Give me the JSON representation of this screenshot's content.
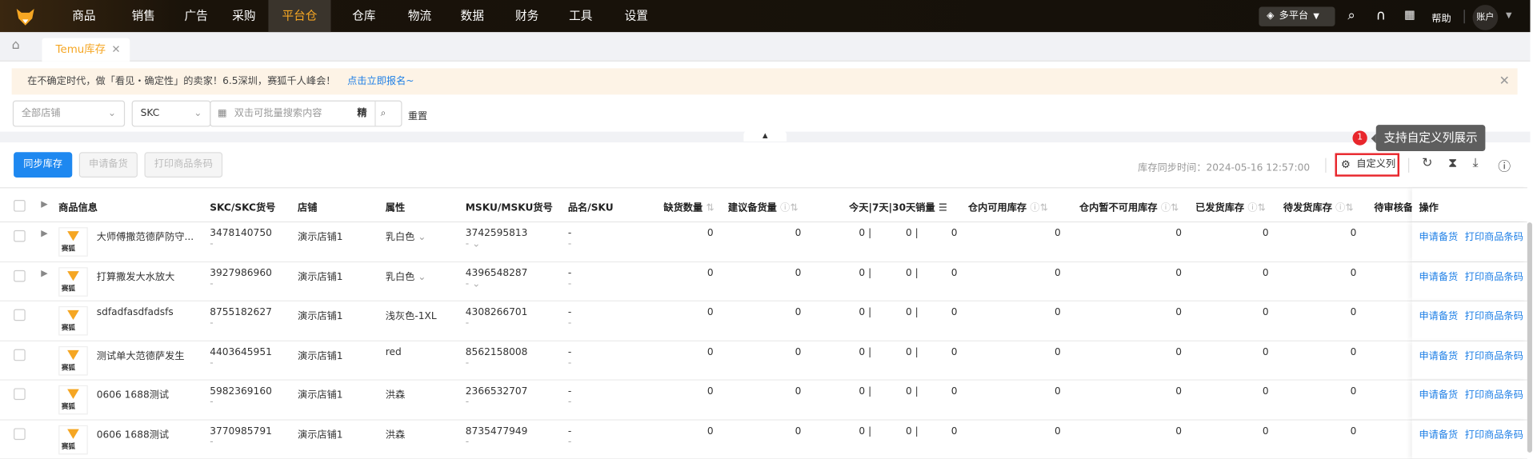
{
  "nav": {
    "items": [
      "商品",
      "销售",
      "广告",
      "采购",
      "平台仓",
      "仓库",
      "物流",
      "数据",
      "财务",
      "工具",
      "设置"
    ],
    "active": "平台仓",
    "platform": "多平台",
    "help": "帮助",
    "account": "账户"
  },
  "tabs": {
    "active": "Temu库存"
  },
  "banner": {
    "text": "在不确定时代，做「看见・确定性」的卖家！6.5深圳，赛狐千人峰会！",
    "link": "点击立即报名~"
  },
  "filters": {
    "store_placeholder": "全部店铺",
    "type": "SKC",
    "search_placeholder": "双击可批量搜索内容",
    "precise": "精",
    "reset": "重置"
  },
  "toolbar": {
    "sync": "同步库存",
    "apply": "申请备货",
    "print": "打印商品条码",
    "sync_time": "库存同步时间：2024-05-16 12:57:00",
    "custom_cols": "自定义列"
  },
  "tooltip": {
    "badge": "1",
    "text": "支持自定义列展示"
  },
  "columns": {
    "info": "商品信息",
    "skc": "SKC/SKC货号",
    "store": "店铺",
    "attr": "属性",
    "msku": "MSKU/MSKU货号",
    "name": "品名/SKU",
    "shortage": "缺货数量",
    "suggest": "建议备货量",
    "sales": "今天|7天|30天销量",
    "avail": "仓内可用库存",
    "unavail": "仓内暂不可用库存",
    "shipped": "已发货库存",
    "pending": "待发货库存",
    "review": "待审核备",
    "ops": "操作"
  },
  "thumb_label": "赛狐",
  "rows": [
    {
      "name": "大师傅撒范德萨防守...",
      "skc": "3478140750",
      "store": "演示店铺1",
      "attr": "乳白色",
      "msku": "3742595813",
      "sku": "-",
      "shortage": "0",
      "suggest": "0",
      "today": "0",
      "d7": "0",
      "d30": "0",
      "avail": "0",
      "unavail": "0",
      "shipped": "0",
      "pending": "0",
      "op1": "申请备货",
      "op2": "打印商品条码",
      "expand": true
    },
    {
      "name": "打算撒发大水放大",
      "skc": "3927986960",
      "store": "演示店铺1",
      "attr": "乳白色",
      "msku": "4396548287",
      "sku": "-",
      "shortage": "0",
      "suggest": "0",
      "today": "0",
      "d7": "0",
      "d30": "0",
      "avail": "0",
      "unavail": "0",
      "shipped": "0",
      "pending": "0",
      "op1": "申请备货",
      "op2": "打印商品条码",
      "expand": true
    },
    {
      "name": "sdfadfasdfadsfs",
      "skc": "8755182627",
      "store": "演示店铺1",
      "attr": "浅灰色-1XL",
      "msku": "4308266701",
      "sku": "-",
      "shortage": "0",
      "suggest": "0",
      "today": "0",
      "d7": "0",
      "d30": "0",
      "avail": "0",
      "unavail": "0",
      "shipped": "0",
      "pending": "0",
      "op1": "申请备货",
      "op2": "打印商品条码",
      "expand": false
    },
    {
      "name": "测试单大范德萨发生",
      "skc": "4403645951",
      "store": "演示店铺1",
      "attr": "red",
      "msku": "8562158008",
      "sku": "-",
      "shortage": "0",
      "suggest": "0",
      "today": "0",
      "d7": "0",
      "d30": "0",
      "avail": "0",
      "unavail": "0",
      "shipped": "0",
      "pending": "0",
      "op1": "申请备货",
      "op2": "打印商品条码",
      "expand": false
    },
    {
      "name": "0606 1688测试",
      "skc": "5982369160",
      "store": "演示店铺1",
      "attr": "洪森",
      "msku": "2366532707",
      "sku": "-",
      "shortage": "0",
      "suggest": "0",
      "today": "0",
      "d7": "0",
      "d30": "0",
      "avail": "0",
      "unavail": "0",
      "shipped": "0",
      "pending": "0",
      "op1": "申请备货",
      "op2": "打印商品条码",
      "expand": false
    },
    {
      "name": "0606 1688测试",
      "skc": "3770985791",
      "store": "演示店铺1",
      "attr": "洪森",
      "msku": "8735477949",
      "sku": "-",
      "shortage": "0",
      "suggest": "0",
      "today": "0",
      "d7": "0",
      "d30": "0",
      "avail": "0",
      "unavail": "0",
      "shipped": "0",
      "pending": "0",
      "op1": "申请备货",
      "op2": "打印商品条码",
      "expand": false
    }
  ]
}
